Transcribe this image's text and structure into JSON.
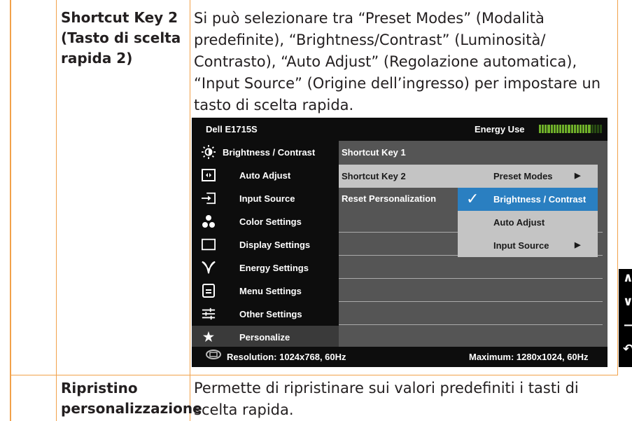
{
  "row1": {
    "label": [
      "Shortcut Key 2",
      "(Tasto di scelta",
      "rapida 2)"
    ],
    "description": [
      "Si può selezionare tra “Preset Modes” (Modalità",
      "predefinite), “Brightness/Contrast” (Luminosità/",
      "Contrasto), “Auto Adjust” (Regolazione automatica),",
      "“Input Source” (Origine dell’ingresso) per impostare un",
      "tasto di scelta rapida."
    ]
  },
  "row2": {
    "label": [
      "Ripristino",
      "personalizzazione"
    ],
    "description": [
      "Permette di ripristinare sui valori predefiniti i tasti di",
      "scelta rapida."
    ]
  },
  "osd": {
    "title": "Dell E1715S",
    "energy_label": "Energy Use",
    "energy_level": 0.8,
    "meter_color": "#6fb02a",
    "menu": [
      {
        "icon": "brightness-icon",
        "label": "Brightness / Contrast"
      },
      {
        "icon": "auto-adjust-icon",
        "label": "Auto Adjust"
      },
      {
        "icon": "input-source-icon",
        "label": "Input Source"
      },
      {
        "icon": "color-settings-icon",
        "label": "Color Settings"
      },
      {
        "icon": "display-settings-icon",
        "label": "Display Settings"
      },
      {
        "icon": "energy-settings-icon",
        "label": "Energy Settings"
      },
      {
        "icon": "menu-settings-icon",
        "label": "Menu Settings"
      },
      {
        "icon": "other-settings-icon",
        "label": "Other Settings"
      },
      {
        "icon": "star-icon",
        "label": "Personalize"
      }
    ],
    "submenu": [
      "Shortcut Key 1",
      "Shortcut Key 2",
      "Reset Personalization"
    ],
    "dropdown": [
      "Preset Modes",
      "Brightness / Contrast",
      "Auto Adjust",
      "Input Source"
    ],
    "selected_option": "Brightness / Contrast",
    "selected_color": "#2a7fc1",
    "resolution": "Resolution: 1024x768, 60Hz",
    "maximum": "Maximum: 1280x1024, 60Hz"
  }
}
